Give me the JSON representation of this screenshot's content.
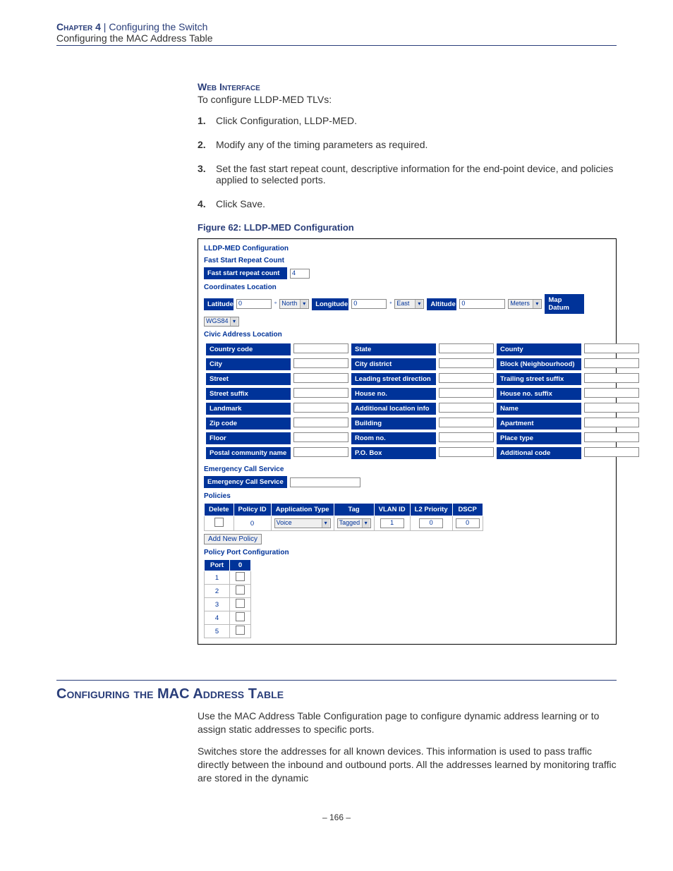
{
  "header": {
    "chapter": "Chapter 4",
    "sep": "  |  ",
    "title": "Configuring the Switch",
    "subtitle": "Configuring the MAC Address Table"
  },
  "section": {
    "heading": "Web Interface",
    "intro": "To configure LLDP-MED TLVs:",
    "steps": [
      {
        "num": "1.",
        "text": "Click Configuration, LLDP-MED."
      },
      {
        "num": "2.",
        "text": "Modify any of the timing parameters as required."
      },
      {
        "num": "3.",
        "text": "Set the fast start repeat count, descriptive information for the end-point device, and policies applied to selected ports."
      },
      {
        "num": "4.",
        "text": "Click Save."
      }
    ],
    "figure_caption": "Figure 62:  LLDP-MED Configuration"
  },
  "figure": {
    "title": "LLDP-MED Configuration",
    "fast_start": {
      "heading": "Fast Start Repeat Count",
      "label": "Fast start repeat count",
      "value": "4"
    },
    "coords": {
      "heading": "Coordinates Location",
      "lat_label": "Latitude",
      "lat_val": "0",
      "lat_dir": "North",
      "lon_label": "Longitude",
      "lon_val": "0",
      "lon_dir": "East",
      "alt_label": "Altitude",
      "alt_val": "0",
      "alt_unit": "Meters",
      "datum_label": "Map Datum",
      "datum_val": "WGS84"
    },
    "civic": {
      "heading": "Civic Address Location",
      "rows": [
        [
          "Country code",
          "State",
          "County"
        ],
        [
          "City",
          "City district",
          "Block (Neighbourhood)"
        ],
        [
          "Street",
          "Leading street direction",
          "Trailing street suffix"
        ],
        [
          "Street suffix",
          "House no.",
          "House no. suffix"
        ],
        [
          "Landmark",
          "Additional location info",
          "Name"
        ],
        [
          "Zip code",
          "Building",
          "Apartment"
        ],
        [
          "Floor",
          "Room no.",
          "Place type"
        ],
        [
          "Postal community name",
          "P.O. Box",
          "Additional code"
        ]
      ]
    },
    "ecs": {
      "heading": "Emergency Call Service",
      "label": "Emergency Call Service"
    },
    "policies": {
      "heading": "Policies",
      "columns": [
        "Delete",
        "Policy ID",
        "Application Type",
        "Tag",
        "VLAN ID",
        "L2 Priority",
        "DSCP"
      ],
      "row": {
        "policy_id": "0",
        "app_type": "Voice",
        "tag": "Tagged",
        "vlan": "1",
        "l2": "0",
        "dscp": "0"
      },
      "add_btn": "Add New Policy"
    },
    "ppc": {
      "heading": "Policy Port Configuration",
      "columns": [
        "Port",
        "0"
      ],
      "ports": [
        "1",
        "2",
        "3",
        "4",
        "5"
      ]
    }
  },
  "mac_section": {
    "heading": "Configuring the MAC Address Table",
    "p1": "Use the MAC Address Table Configuration page to configure dynamic address learning or to assign static addresses to specific ports.",
    "p2": "Switches store the addresses for all known devices. This information is used to pass traffic directly between the inbound and outbound ports. All the addresses learned by monitoring traffic are stored in the dynamic"
  },
  "footer": {
    "page": "–  166  –"
  }
}
